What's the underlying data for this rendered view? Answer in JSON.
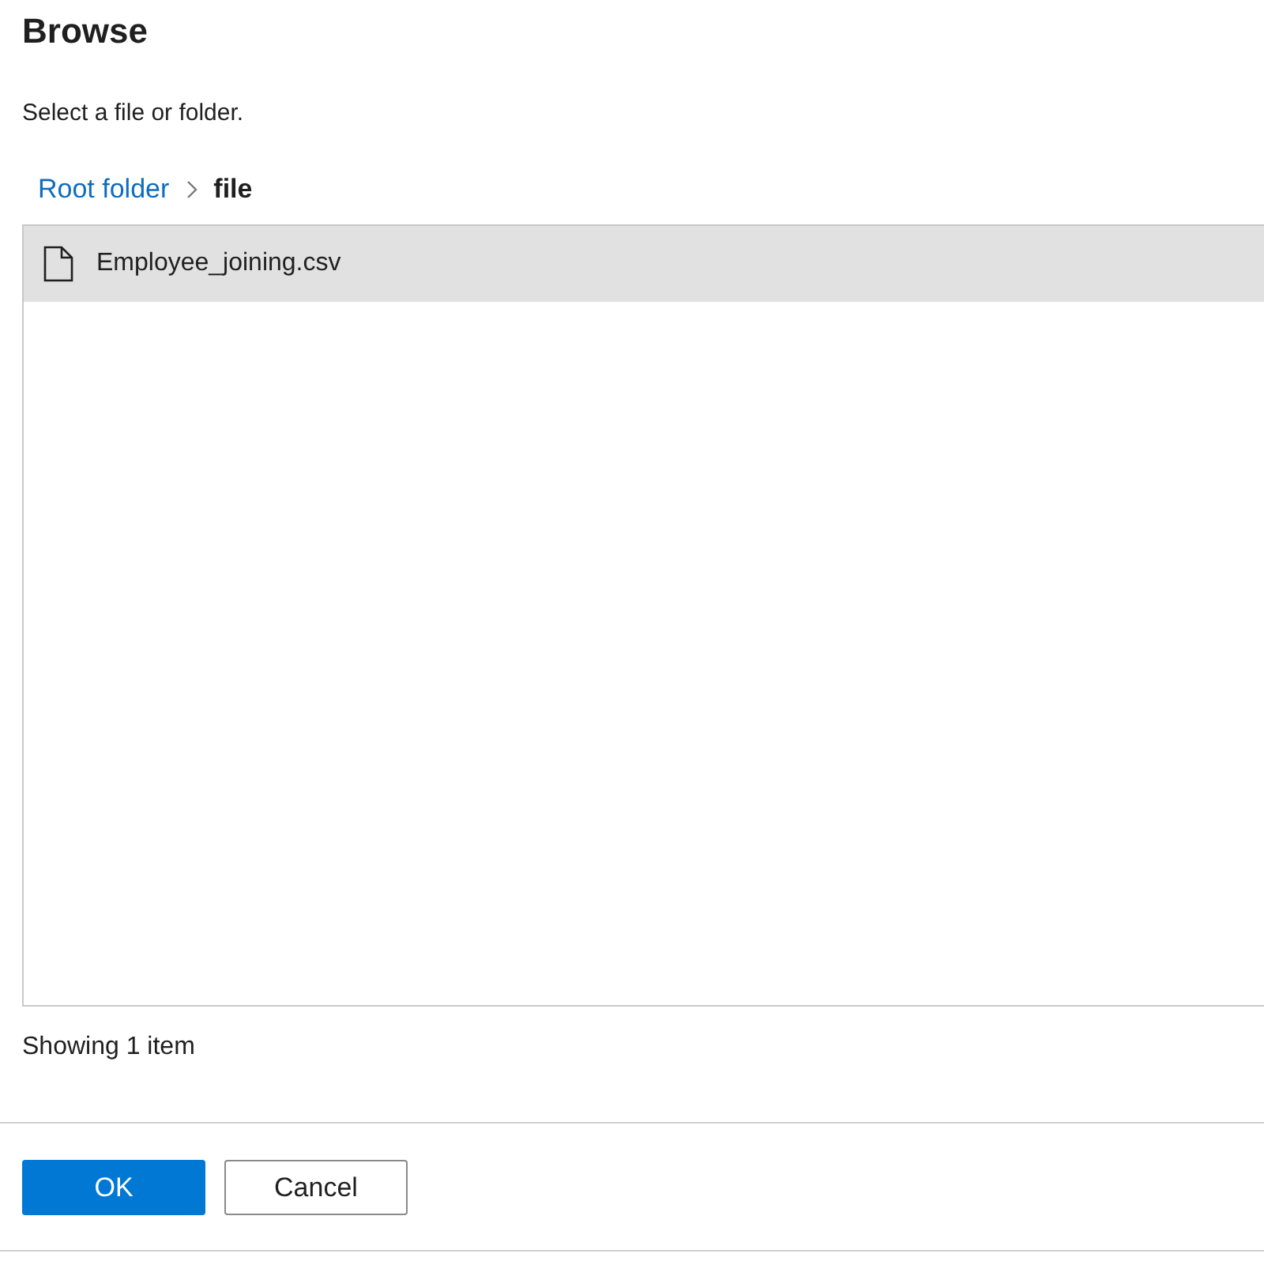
{
  "title": "Browse",
  "description": "Select a file or folder.",
  "breadcrumb": [
    {
      "label": "Root folder",
      "current": false
    },
    {
      "label": "file",
      "current": true
    }
  ],
  "items": [
    {
      "name": "Employee_joining.csv",
      "kind": "file",
      "selected": true
    }
  ],
  "status": "Showing 1 item",
  "buttons": [
    {
      "label": "OK",
      "kind": "primary"
    },
    {
      "label": "Cancel",
      "kind": "secondary"
    }
  ]
}
